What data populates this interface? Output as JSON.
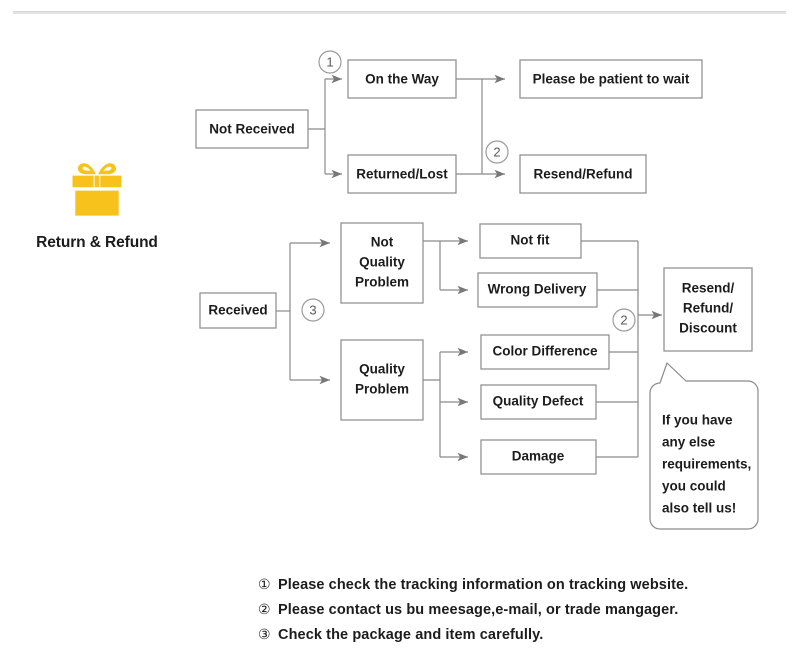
{
  "brand": {
    "icon": "gift-box-icon",
    "icon_color": "#f7c21c",
    "title": "Return & Refund"
  },
  "colors": {
    "line": "#8a8a8a",
    "arrow": "#777777",
    "box_border": "#8a8a8a",
    "text": "#1c1c1c",
    "rule": "#e2e2e2",
    "gift": "#f7c21c"
  },
  "diagram": {
    "type": "flowchart",
    "nodes": {
      "not_received": "Not Received",
      "on_the_way": "On the Way",
      "returned_lost": "Returned/Lost",
      "please_wait": "Please be patient to wait",
      "resend_refund": "Resend/Refund",
      "received": "Received",
      "not_quality_problem": [
        "Not",
        "Quality",
        "Problem"
      ],
      "quality_problem": [
        "Quality",
        "Problem"
      ],
      "not_fit": "Not fit",
      "wrong_delivery": "Wrong Delivery",
      "color_difference": "Color Difference",
      "quality_defect": "Quality Defect",
      "damage": "Damage",
      "resend_refund_discount": [
        "Resend/",
        "Refund/",
        "Discount"
      ]
    },
    "markers": {
      "one_top": "1",
      "two_top": "2",
      "three_mid": "3",
      "two_right": "2"
    },
    "callout": {
      "name": "speech-bubble",
      "lines": [
        "If you have",
        "any else",
        "requirements,",
        "you could",
        "also tell us!"
      ]
    }
  },
  "notes": [
    {
      "mark": "①",
      "text": "Please check the tracking information on tracking website."
    },
    {
      "mark": "②",
      "text": "Please contact us bu meesage,e-mail, or trade mangager."
    },
    {
      "mark": "③",
      "text": "Check the package and item carefully."
    }
  ]
}
